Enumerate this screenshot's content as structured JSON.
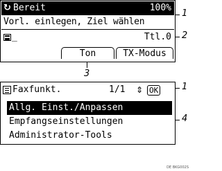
{
  "screen1": {
    "status_text": "Bereit",
    "percent": "100%",
    "message": "Vorl. einlegen, Ziel wählen",
    "input_cursor": "_",
    "total": "Ttl.0",
    "softkeys": [
      "Ton",
      "TX-Modus"
    ]
  },
  "screen2": {
    "title": "Faxfunkt.",
    "page": "1/1",
    "ok_label": "OK",
    "menu_items": [
      "Allg. Einst./Anpassen",
      "Empfangseinstellungen",
      "Administrator-Tools"
    ],
    "selected_index": 0
  },
  "callouts": [
    "1",
    "2",
    "3",
    "1",
    "4"
  ],
  "code": "DE BKG002S"
}
